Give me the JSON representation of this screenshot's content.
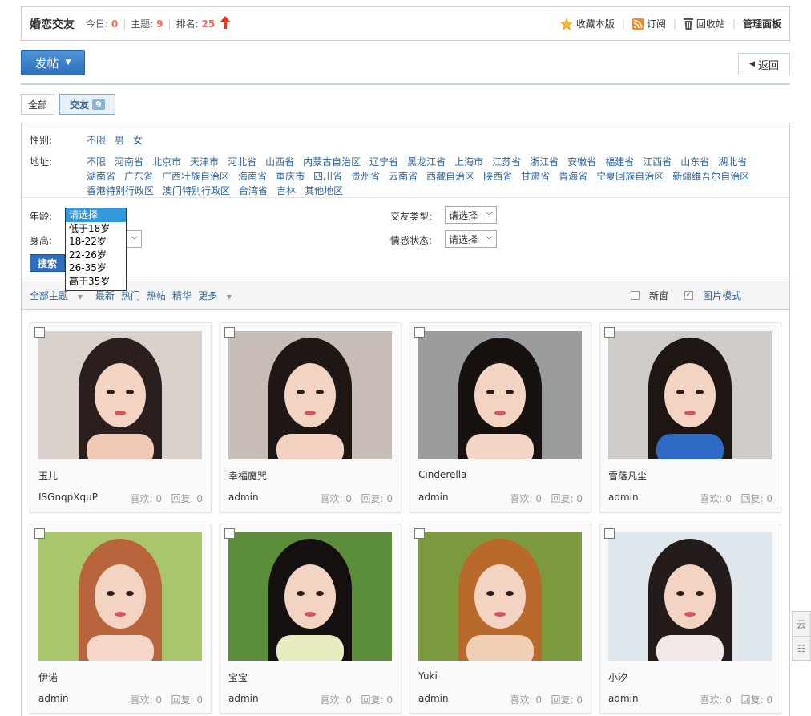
{
  "header": {
    "title": "婚恋交友",
    "today_label": "今日:",
    "today_value": "0",
    "topics_label": "主题:",
    "topics_value": "9",
    "rank_label": "排名:",
    "rank_value": "25",
    "favorite": "收藏本版",
    "subscribe": "订阅",
    "recycle": "回收站",
    "admin_panel": "管理面板"
  },
  "post_button": "发帖",
  "back_button": "返回",
  "tabs": [
    {
      "label": "全部"
    },
    {
      "label": "交友",
      "badge": "9"
    }
  ],
  "filters": {
    "gender_label": "性别:",
    "gender_options": [
      "不限",
      "男",
      "女"
    ],
    "region_label": "地址:",
    "region_options": [
      "不限",
      "河南省",
      "北京市",
      "天津市",
      "河北省",
      "山西省",
      "内蒙古自治区",
      "辽宁省",
      "黑龙江省",
      "上海市",
      "江苏省",
      "浙江省",
      "安徽省",
      "福建省",
      "江西省",
      "山东省",
      "湖北省",
      "湖南省",
      "广东省",
      "广西壮族自治区",
      "海南省",
      "重庆市",
      "四川省",
      "贵州省",
      "云南省",
      "西藏自治区",
      "陕西省",
      "甘肃省",
      "青海省",
      "宁夏回族自治区",
      "新疆维吾尔自治区",
      "香港特别行政区",
      "澳门特别行政区",
      "台湾省",
      "吉林",
      "其他地区"
    ],
    "age_label": "年龄:",
    "height_label": "身高:",
    "friend_type_label": "交友类型:",
    "emotion_label": "情感状态:",
    "select_placeholder": "请选择",
    "age_options": [
      "请选择",
      "低于18岁",
      "18-22岁",
      "22-26岁",
      "26-35岁",
      "高于35岁"
    ],
    "search_button": "搜索"
  },
  "toolbar": {
    "all_topics": "全部主题",
    "latest": "最新",
    "hot": "热门",
    "hot_posts": "热帖",
    "digest": "精华",
    "more": "更多",
    "new_window": "新窗",
    "image_mode": "图片模式"
  },
  "cards": [
    {
      "name": "玉儿",
      "author": "ISGnqpXquP",
      "likes": "喜欢: 0",
      "replies": "回复: 0"
    },
    {
      "name": "幸福魔咒",
      "author": "admin",
      "likes": "喜欢: 0",
      "replies": "回复: 0"
    },
    {
      "name": "Cinderella",
      "author": "admin",
      "likes": "喜欢: 0",
      "replies": "回复: 0"
    },
    {
      "name": "雪落凡尘",
      "author": "admin",
      "likes": "喜欢: 0",
      "replies": "回复: 0"
    },
    {
      "name": "伊诺",
      "author": "admin",
      "likes": "喜欢: 0",
      "replies": "回复: 0"
    },
    {
      "name": "宝宝",
      "author": "admin",
      "likes": "喜欢: 0",
      "replies": "回复: 0"
    },
    {
      "name": "Yuki",
      "author": "admin",
      "likes": "喜欢: 0",
      "replies": "回复: 0"
    },
    {
      "name": "小汐",
      "author": "admin",
      "likes": "喜欢: 0",
      "replies": "回复: 0"
    }
  ],
  "side_buttons": [
    "云",
    "☷"
  ],
  "colors": {
    "accent": "#2d6fbc",
    "link": "#336699",
    "highlight": "#f26c4f"
  }
}
